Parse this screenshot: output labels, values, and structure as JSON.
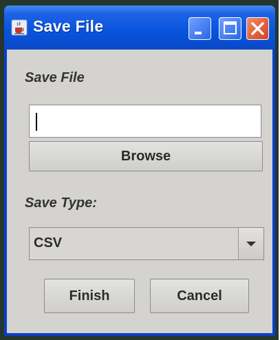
{
  "window": {
    "title": "Save File",
    "app_icon": "java-cup-icon",
    "controls": {
      "minimize": "minimize-icon",
      "maximize": "maximize-icon",
      "close": "close-icon"
    }
  },
  "form": {
    "save_file_label": "Save File",
    "file_path_value": "",
    "browse_label": "Browse",
    "save_type_label": "Save Type:",
    "save_type_selected": "CSV",
    "finish_label": "Finish",
    "cancel_label": "Cancel"
  },
  "colors": {
    "titlebar_blue": "#0855dd",
    "close_red": "#d2431d",
    "panel_gray": "#d4d3d0"
  }
}
